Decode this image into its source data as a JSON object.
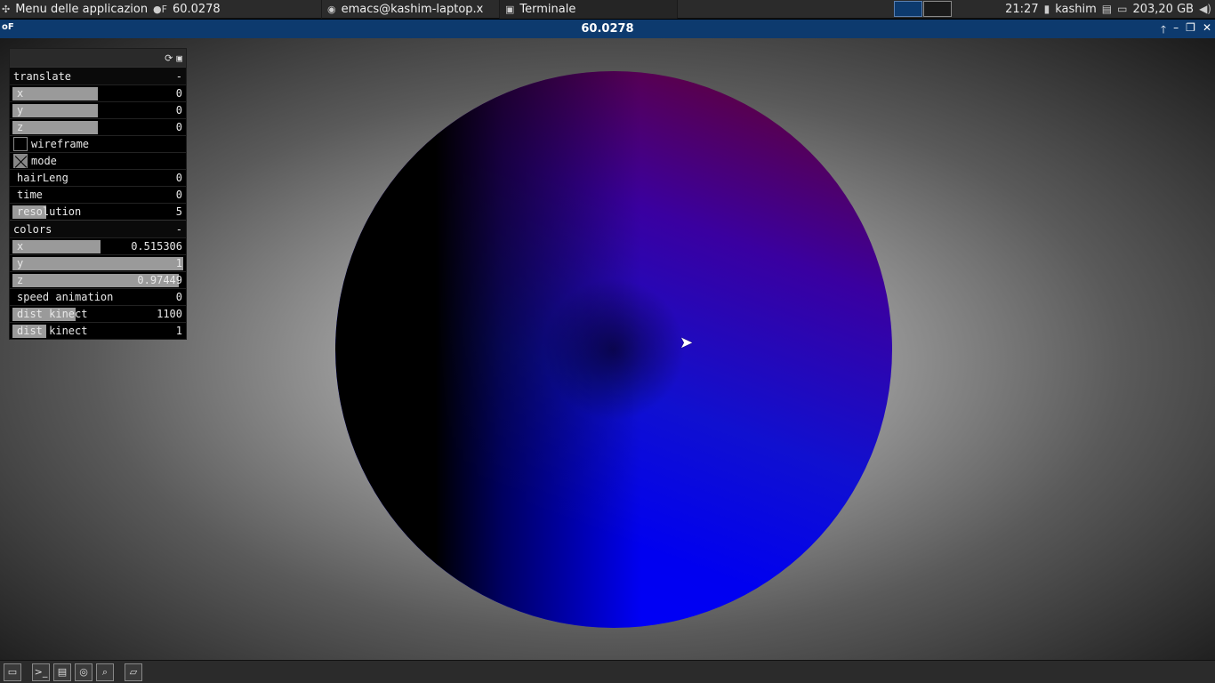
{
  "taskbar": {
    "apps_menu_label": "Menu delle applicazioni",
    "windows": [
      {
        "label": "60.0278",
        "icon": "of-icon"
      },
      {
        "label": "emacs@kashim-laptop.x",
        "icon": "emacs-icon"
      },
      {
        "label": "Terminale",
        "icon": "terminal-icon"
      }
    ],
    "clock": "21:27",
    "user": "kashim",
    "disk": "203,20 GB"
  },
  "window": {
    "title": "60.0278",
    "app_icon": "oF"
  },
  "gui": {
    "translate": {
      "title": "translate",
      "collapse": "-",
      "x": {
        "label": "x",
        "value": "0",
        "fill": 0.5
      },
      "y": {
        "label": "y",
        "value": "0",
        "fill": 0.5
      },
      "z": {
        "label": "z",
        "value": "0",
        "fill": 0.5
      }
    },
    "wireframe": {
      "label": "wireframe",
      "checked": false
    },
    "mode": {
      "label": "mode",
      "checked": true
    },
    "hairLeng": {
      "label": "hairLeng",
      "value": "0"
    },
    "time": {
      "label": "time",
      "value": "0"
    },
    "resolution": {
      "label": "resolution",
      "value": "5",
      "fill": 0.2
    },
    "colors": {
      "title": "colors",
      "collapse": "-",
      "x": {
        "label": "x",
        "value": "0.515306",
        "fill": 0.515306
      },
      "y": {
        "label": "y",
        "value": "1",
        "fill": 1
      },
      "z": {
        "label": "z",
        "value": "0.97449",
        "fill": 0.97449
      }
    },
    "speed_animation": {
      "label": "speed animation",
      "value": "0"
    },
    "dist_kinect_1": {
      "label": "dist kinect",
      "value": "1100",
      "fill": 0.37
    },
    "dist_kinect_2": {
      "label": "dist kinect",
      "value": "1",
      "fill": 0.2
    }
  },
  "colors": {
    "titlebar": "#0d3a6e",
    "taskbar": "#2b2b2b"
  }
}
